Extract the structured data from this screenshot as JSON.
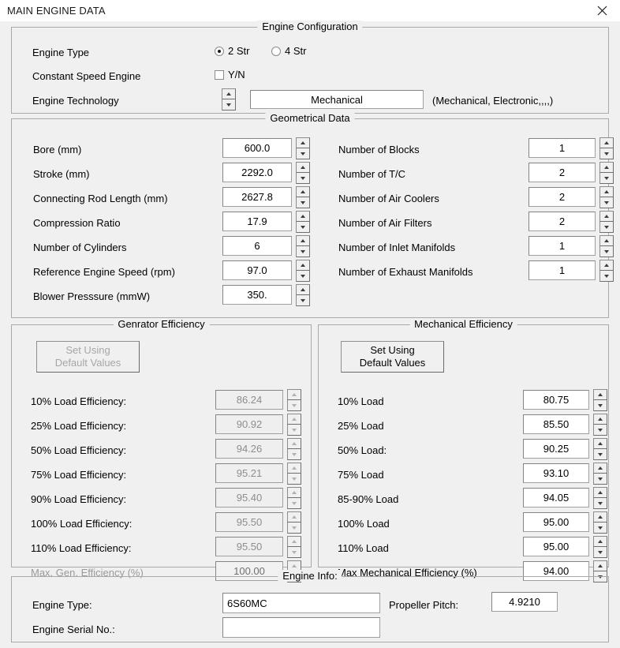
{
  "window": {
    "title": "MAIN ENGINE DATA",
    "close_label": "close-icon"
  },
  "engine_configuration": {
    "title": "Engine Configuration",
    "engine_type_label": "Engine Type",
    "radio_2str": "2 Str",
    "radio_4str": "4 Str",
    "radio_selected": "2 Str",
    "constant_speed_label": "Constant Speed Engine",
    "constant_speed_checkbox_label": "Y/N",
    "constant_speed_checked": false,
    "engine_technology_label": "Engine Technology",
    "engine_technology_value": "Mechanical",
    "engine_technology_hint": "(Mechanical, Electronic,,,,)"
  },
  "geometrical_data": {
    "title": "Geometrical Data",
    "left_rows": [
      {
        "label": "Bore (mm)",
        "value": "600.0"
      },
      {
        "label": "Stroke (mm)",
        "value": "2292.0"
      },
      {
        "label": "Connecting Rod Length (mm)",
        "value": "2627.8"
      },
      {
        "label": "Compression Ratio",
        "value": "17.9"
      },
      {
        "label": "Number of Cylinders",
        "value": "6"
      },
      {
        "label": "Reference Engine Speed (rpm)",
        "value": "97.0"
      },
      {
        "label": "Blower Presssure (mmW)",
        "value": "350."
      }
    ],
    "right_rows": [
      {
        "label": "Number of Blocks",
        "value": "1"
      },
      {
        "label": "Number of T/C",
        "value": "2"
      },
      {
        "label": "Number of Air Coolers",
        "value": "2"
      },
      {
        "label": "Number of Air Filters",
        "value": "2"
      },
      {
        "label": "Number of Inlet Manifolds",
        "value": "1"
      },
      {
        "label": "Number of Exhaust  Manifolds",
        "value": "1"
      }
    ]
  },
  "generator_efficiency": {
    "title": "Genrator Efficiency",
    "set_default_line1": "Set Using",
    "set_default_line2": "Default Values",
    "rows": [
      {
        "label": "10% Load Efficiency:",
        "value": "86.24"
      },
      {
        "label": "25% Load Efficiency:",
        "value": "90.92"
      },
      {
        "label": "50% Load Efficiency:",
        "value": "94.26"
      },
      {
        "label": "75% Load Efficiency:",
        "value": "95.21"
      },
      {
        "label": "90% Load Efficiency:",
        "value": "95.40"
      },
      {
        "label": "100% Load Efficiency:",
        "value": "95.50"
      },
      {
        "label": "110% Load Efficiency:",
        "value": "95.50"
      },
      {
        "label": "Max. Gen. Efficiency (%)",
        "value": "100.00"
      }
    ]
  },
  "mechanical_efficiency": {
    "title": "Mechanical Efficiency",
    "set_default_line1": "Set Using",
    "set_default_line2": "Default Values",
    "rows": [
      {
        "label": "10% Load",
        "value": "80.75"
      },
      {
        "label": "25% Load",
        "value": "85.50"
      },
      {
        "label": "50% Load:",
        "value": "90.25"
      },
      {
        "label": "75% Load",
        "value": "93.10"
      },
      {
        "label": "85-90% Load",
        "value": "94.05"
      },
      {
        "label": "100% Load",
        "value": "95.00"
      },
      {
        "label": "110% Load",
        "value": "95.00"
      },
      {
        "label": "Max Mechanical Efficiency (%)",
        "value": "94.00"
      }
    ]
  },
  "engine_info": {
    "title": "Engine Info:",
    "engine_type_label": "Engine Type:",
    "engine_type_value": "6S60MC",
    "engine_serial_label": "Engine Serial No.:",
    "engine_serial_value": "",
    "propeller_pitch_label": "Propeller Pitch:",
    "propeller_pitch_value": "4.9210"
  },
  "colors": {
    "surface": "#f0f0f0",
    "border": "#a9a9a9",
    "field_bg": "#ffffff",
    "disabled_text": "#9a9a9a"
  }
}
